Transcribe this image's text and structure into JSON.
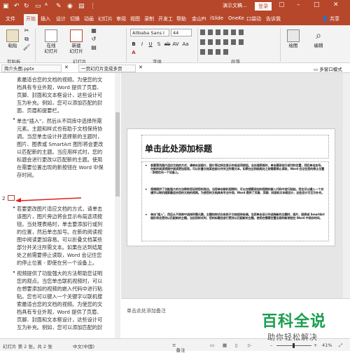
{
  "titlebar": {
    "doc_title": "演示文稿...",
    "login": "登录",
    "brand_color": "#b7472a"
  },
  "tabs": [
    "文件",
    "开始",
    "插入",
    "设计",
    "切换",
    "动画",
    "幻灯片",
    "审阅",
    "视图",
    "录制",
    "开发工",
    "帮助",
    "金山PI",
    "iSlide",
    "OneKe",
    "口袋动",
    "告诉我"
  ],
  "active_tab": "开始",
  "share_label": "共享",
  "ribbon": {
    "paste": "粘贴",
    "clipboard": "剪贴板",
    "online_slide": "在线\n幻灯片",
    "online_slide_l1": "在线",
    "online_slide_l2": "幻灯片",
    "new_slide_l1": "新建",
    "new_slide_l2": "幻灯片",
    "slides_group": "幻灯片",
    "font_group": "字体",
    "para_group": "段落",
    "drawing": "绘图",
    "editing": "编辑",
    "font_name": "Alibaba Sans I",
    "font_size": "44",
    "fmt_buttons": [
      "B",
      "I",
      "U",
      "S",
      "ab",
      "AV",
      "Aa",
      "A"
    ]
  },
  "panes": {
    "tab1": "简介头图.pptx",
    "tab2": "一页幻灯片变成多页",
    "view_label": "多窗口模式"
  },
  "outline": {
    "slide_number": "2",
    "bullets_top": [
      {
        "lines": [
          "素最适合您的文档的视频。为使您的文",
          "档具有专业外观，Word 提供了页眉、",
          "页脚、封面和文本框设计，这些设计可",
          "互为补充。例如，您可以添加匹配的封",
          "面、页眉和提要栏。"
        ]
      },
      {
        "lines": [
          "单击\"插入\"，然后从不同库中选择所需",
          "元素。主题和样式也有助于文档保持协",
          "调。当您单击设计并选择新的主题时，",
          "图片、图表或 SmartArt 图形将会更改",
          "以匹配新的主题。当应用样式时，您的",
          "标题会进行更改以匹配新的主题。使用",
          "在需要位置出现的新按钮在 Word 中保",
          "存时间。"
        ]
      }
    ],
    "bullets_bottom": [
      {
        "lines": [
          "若要更改图片适应文档的方式，请单击",
          "该图片，图片旁边将会显示布局选项按",
          "钮。当处理表格时，单击要添加行或列",
          "的位置，然后单击加号。在新的阅读视",
          "图中阅读更加容易。可以折叠文档某些",
          "部分并关注所需文本。如果在达到结尾",
          "处之前需要停止读取，Word 会记住您",
          "的停止位置 - 即使在另一个设备上。"
        ]
      },
      {
        "lines": [
          "视频提供了功能强大的方法帮助您证明",
          "您的观点。当您单击联机视频时，可以",
          "在想要添加的视频的嵌入代码中进行粘",
          "贴。您也可以键入一个关键字以联机搜",
          "索最适合您的文档的视频。为使您的文",
          "档具有专业外观，Word 提供了页眉、",
          "页脚、封面和文本框设计，这些设计可",
          "互为补充。例如，您可以添加匹配的封"
        ]
      }
    ]
  },
  "slide": {
    "title": "单击此处添加标题",
    "bullets": [
      "若要更改图片适应文档的方式，请单击该图片，图片旁边将会显示布局选项按钮。当处理表格时，单击要添加行或列的位置，然后单击加号。在新的阅读视图中阅读更加容易。可以折叠文档某些部分并关注所需文本。如果在达到结尾处之前需要停止读取，Word 会记住您的停止位置 - 即使在另一个设备上。",
      "视频提供了功能强大的方法帮助您证明您的观点。当您单击联机视频时，可以在想要添加的视频的嵌入代码中进行粘贴。您也可以键入一个关键字以联机搜索最适合您的文档的视频。为使您的文档具有专业外观，Word 提供了页眉、页脚、封面和文本框设计，这些设计可互为补充。",
      "单击\"插入\"，然后从不同库中选择所需元素。主题和样式也有助于文档保持协调。当您单击设计并选择新的主题时，图片、图表或 SmartArt 图形将会更改以匹配新的主题。当应用样式时，您的标题会进行更改以匹配新的主题。使用在需要位置出现的新按钮在 Word 中保存时间。"
    ]
  },
  "notes_placeholder": "单击此处添加备注",
  "status": {
    "slide_info": "幻灯片 第 2 张，共 2 张",
    "language": "中文(中国)",
    "notes": "备注",
    "zoom": "41%"
  },
  "watermark": {
    "big": "百科全说",
    "small": "助你轻松解决"
  }
}
